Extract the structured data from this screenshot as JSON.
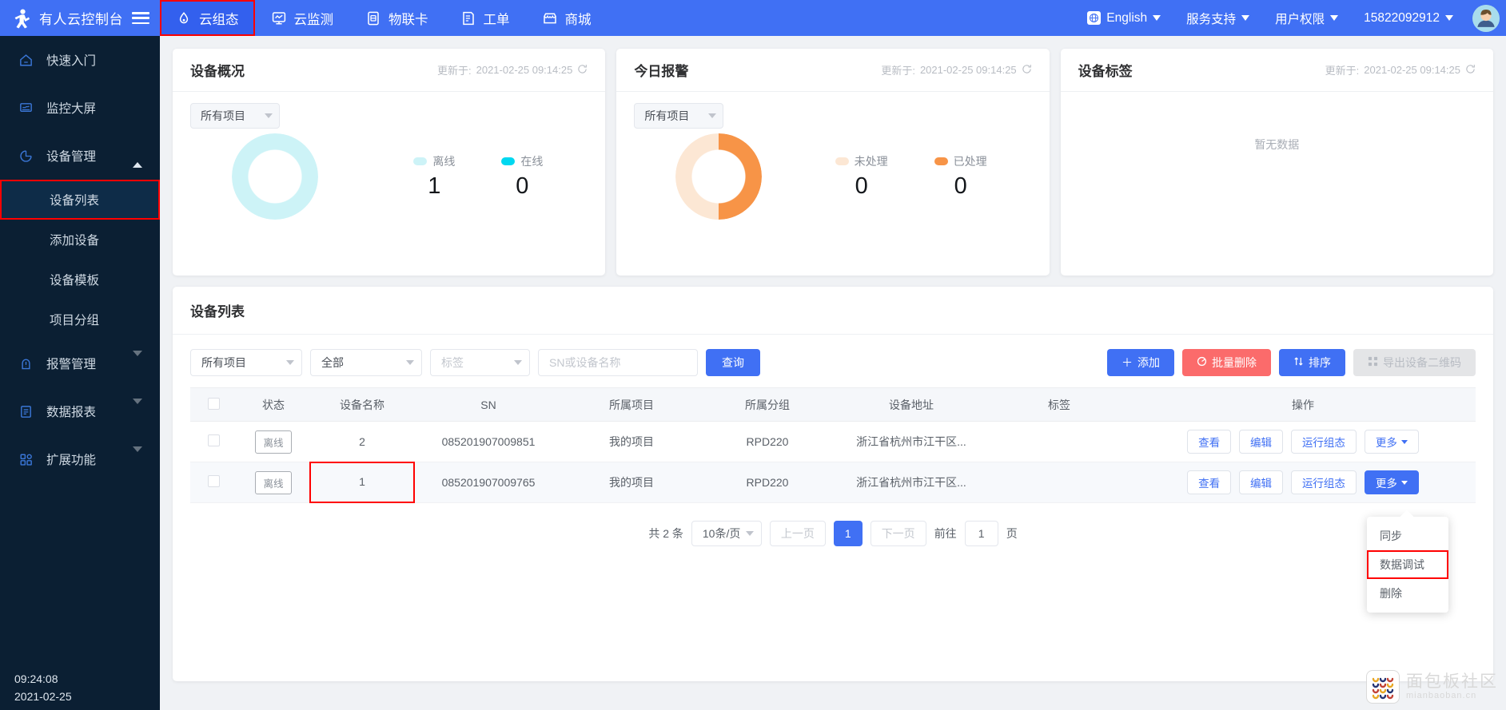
{
  "header": {
    "brand": "有人云控制台",
    "logo_icon": "person-running-icon",
    "menu_icon": "hamburger-icon",
    "nav": [
      {
        "label": "云组态",
        "icon": "cloud-icon",
        "active": true
      },
      {
        "label": "云监测",
        "icon": "monitor-icon",
        "active": false
      },
      {
        "label": "物联卡",
        "icon": "sim-card-icon",
        "active": false
      },
      {
        "label": "工单",
        "icon": "document-icon",
        "active": false
      },
      {
        "label": "商城",
        "icon": "shop-icon",
        "active": false
      }
    ],
    "right": {
      "language": "English",
      "language_icon": "globe-icon",
      "support": "服务支持",
      "permission": "用户权限",
      "account": "15822092912",
      "avatar_icon": "user-avatar"
    }
  },
  "sidebar": {
    "items": [
      {
        "label": "快速入门",
        "icon": "home-icon",
        "arrow": ""
      },
      {
        "label": "监控大屏",
        "icon": "screen-icon",
        "arrow": ""
      },
      {
        "label": "设备管理",
        "icon": "pie-icon",
        "arrow": "up"
      }
    ],
    "sub_items": [
      {
        "label": "设备列表",
        "active": true,
        "highlight": true
      },
      {
        "label": "添加设备",
        "active": false,
        "highlight": false
      },
      {
        "label": "设备模板",
        "active": false,
        "highlight": false
      },
      {
        "label": "项目分组",
        "active": false,
        "highlight": false
      }
    ],
    "items_bottom": [
      {
        "label": "报警管理",
        "icon": "alarm-icon",
        "arrow": "down"
      },
      {
        "label": "数据报表",
        "icon": "report-icon",
        "arrow": "down"
      },
      {
        "label": "扩展功能",
        "icon": "grid-icon",
        "arrow": "down"
      }
    ],
    "clock": "09:24:08",
    "date": "2021-02-25"
  },
  "cards": {
    "device_overview": {
      "title": "设备概况",
      "updated_prefix": "更新于:",
      "updated_at": "2021-02-25 09:14:25",
      "refresh_icon": "refresh-icon",
      "filter": "所有项目",
      "legend": [
        {
          "label": "离线",
          "value": "1",
          "color": "#cdf3f7"
        },
        {
          "label": "在线",
          "value": "0",
          "color": "#00d8f0"
        }
      ]
    },
    "today_alarm": {
      "title": "今日报警",
      "updated_prefix": "更新于:",
      "updated_at": "2021-02-25 09:14:25",
      "refresh_icon": "refresh-icon",
      "filter": "所有项目",
      "legend": [
        {
          "label": "未处理",
          "value": "0",
          "color": "#fce7d4"
        },
        {
          "label": "已处理",
          "value": "0",
          "color": "#f79447"
        }
      ]
    },
    "device_tag": {
      "title": "设备标签",
      "updated_prefix": "更新于:",
      "updated_at": "2021-02-25 09:14:25",
      "refresh_icon": "refresh-icon",
      "empty_text": "暂无数据"
    }
  },
  "chart_data": [
    {
      "type": "pie",
      "title": "设备概况",
      "labels": [
        "离线",
        "在线"
      ],
      "values": [
        1,
        0
      ],
      "colors": [
        "#cdf3f7",
        "#00d8f0"
      ],
      "legend": "right",
      "donut": true
    },
    {
      "type": "pie",
      "title": "今日报警",
      "labels": [
        "未处理",
        "已处理"
      ],
      "values": [
        0,
        0
      ],
      "colors": [
        "#fce7d4",
        "#f79447"
      ],
      "legend": "right",
      "donut": true
    }
  ],
  "device_list": {
    "title": "设备列表",
    "filters": {
      "project": "所有项目",
      "status": "全部",
      "tag_placeholder": "标签",
      "search_placeholder": "SN或设备名称",
      "search_button": "查询"
    },
    "actions": [
      {
        "label": "添加",
        "icon": "plus-icon",
        "style": "primary"
      },
      {
        "label": "批量删除",
        "icon": "delete-icon",
        "style": "danger"
      },
      {
        "label": "排序",
        "icon": "sort-icon",
        "style": "primary"
      },
      {
        "label": "导出设备二维码",
        "icon": "qrcode-icon",
        "style": "disabled"
      }
    ],
    "columns": [
      "",
      "状态",
      "设备名称",
      "SN",
      "所属项目",
      "所属分组",
      "设备地址",
      "标签",
      "操作"
    ],
    "rows": [
      {
        "status": "离线",
        "name": "2",
        "sn": "085201907009851",
        "project": "我的项目",
        "group": "RPD220",
        "address": "浙江省杭州市江干区...",
        "tag": "",
        "name_highlight": false,
        "more_active": false,
        "ops": [
          "查看",
          "编辑",
          "运行组态",
          "更多"
        ]
      },
      {
        "status": "离线",
        "name": "1",
        "sn": "085201907009765",
        "project": "我的项目",
        "group": "RPD220",
        "address": "浙江省杭州市江干区...",
        "tag": "",
        "name_highlight": true,
        "more_active": true,
        "ops": [
          "查看",
          "编辑",
          "运行组态",
          "更多"
        ]
      }
    ],
    "more_menu": [
      {
        "label": "同步",
        "highlight": false
      },
      {
        "label": "数据调试",
        "highlight": true
      },
      {
        "label": "删除",
        "highlight": false
      }
    ],
    "pagination": {
      "total_text": "共 2 条",
      "page_size": "10条/页",
      "prev": "上一页",
      "current": "1",
      "next": "下一页",
      "goto_prefix": "前往",
      "goto_value": "1",
      "goto_suffix": "页"
    }
  },
  "watermark": {
    "cn": "面包板社区",
    "en": "mianbaoban.cn",
    "icon": "mbb-logo-icon"
  },
  "colors": {
    "brand_blue": "#4070f4",
    "sidebar_dark": "#0b1f33",
    "danger": "#fb6b6b",
    "highlight_red": "#ff0000"
  }
}
